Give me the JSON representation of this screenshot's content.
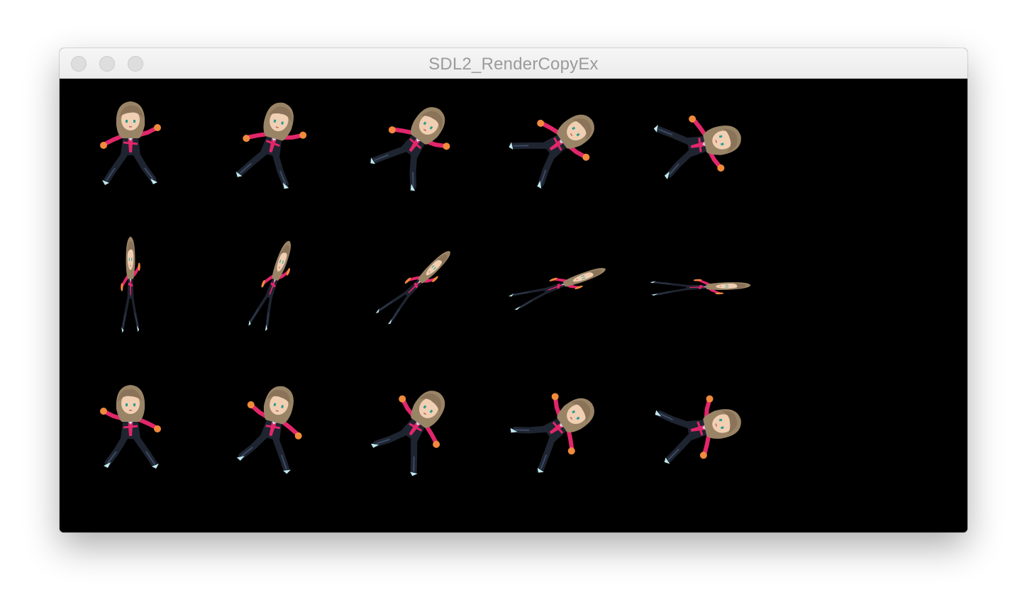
{
  "window": {
    "title": "SDL2_RenderCopyEx",
    "controls": [
      "close-icon",
      "minimize-icon",
      "zoom-icon"
    ],
    "control_color": "#dedede"
  },
  "canvas": {
    "background": "#000000",
    "sprite": {
      "hair_color": "#9a8466",
      "skin_color": "#f1cfb3",
      "suit_color": "#1e2430",
      "accent_color": "#e2266a",
      "glove_color": "#f08a3c",
      "shoe_color": "#bfe9ef"
    }
  }
}
